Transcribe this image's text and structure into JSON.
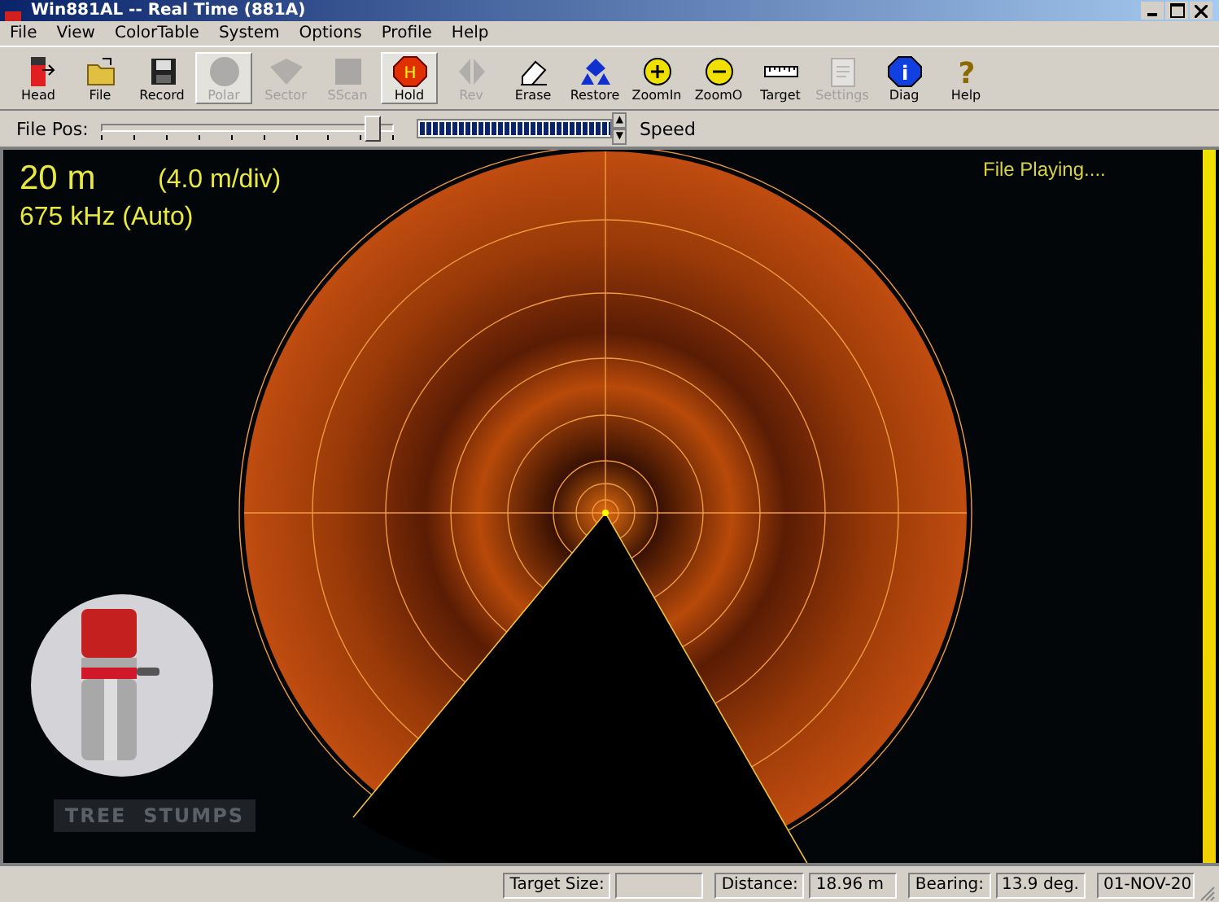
{
  "window": {
    "title": "Win881AL -- Real Time (881A)"
  },
  "menu": [
    "File",
    "View",
    "ColorTable",
    "System",
    "Options",
    "Profile",
    "Help"
  ],
  "toolbar": [
    {
      "kind": "head",
      "label": "Head",
      "disabled": false,
      "pressed": false
    },
    {
      "kind": "file",
      "label": "File",
      "disabled": false,
      "pressed": false
    },
    {
      "kind": "record",
      "label": "Record",
      "disabled": false,
      "pressed": false
    },
    {
      "kind": "polar",
      "label": "Polar",
      "disabled": true,
      "pressed": true
    },
    {
      "kind": "sector",
      "label": "Sector",
      "disabled": true,
      "pressed": false
    },
    {
      "kind": "sscan",
      "label": "SScan",
      "disabled": true,
      "pressed": false
    },
    {
      "kind": "hold",
      "label": "Hold",
      "disabled": false,
      "pressed": true,
      "icon_text": "H"
    },
    {
      "kind": "rev",
      "label": "Rev",
      "disabled": true,
      "pressed": false
    },
    {
      "kind": "erase",
      "label": "Erase",
      "disabled": false,
      "pressed": false
    },
    {
      "kind": "restore",
      "label": "Restore",
      "disabled": false,
      "pressed": false
    },
    {
      "kind": "zoomin",
      "label": "ZoomIn",
      "disabled": false,
      "pressed": false
    },
    {
      "kind": "zoomout",
      "label": "ZoomO",
      "disabled": false,
      "pressed": false
    },
    {
      "kind": "target",
      "label": "Target",
      "disabled": false,
      "pressed": false
    },
    {
      "kind": "settings",
      "label": "Settings",
      "disabled": true,
      "pressed": false
    },
    {
      "kind": "diag",
      "label": "Diag",
      "disabled": false,
      "pressed": false,
      "icon_text": "i"
    },
    {
      "kind": "help",
      "label": "Help",
      "disabled": false,
      "pressed": false,
      "icon_text": "?"
    }
  ],
  "playback": {
    "file_pos_label": "File Pos:",
    "file_pos": {
      "level": 0.92
    },
    "speed": {
      "level": 1
    },
    "speed_up": "▲",
    "speed_down": "▼",
    "speed_label": "Speed"
  },
  "sonar": {
    "range": "20 m",
    "scale": "(4.0 m/div)",
    "frequency": "675 kHz (Auto)",
    "status": "File Playing....",
    "target_label": "TREE  STUMPS"
  },
  "status_bar": [
    {
      "label": "Target Size:"
    },
    {
      "label": "Distance:",
      "value": "18.96 m"
    },
    {
      "label": "Bearing:",
      "value": "13.9 deg."
    }
  ],
  "status_date": "01-NOV-20"
}
